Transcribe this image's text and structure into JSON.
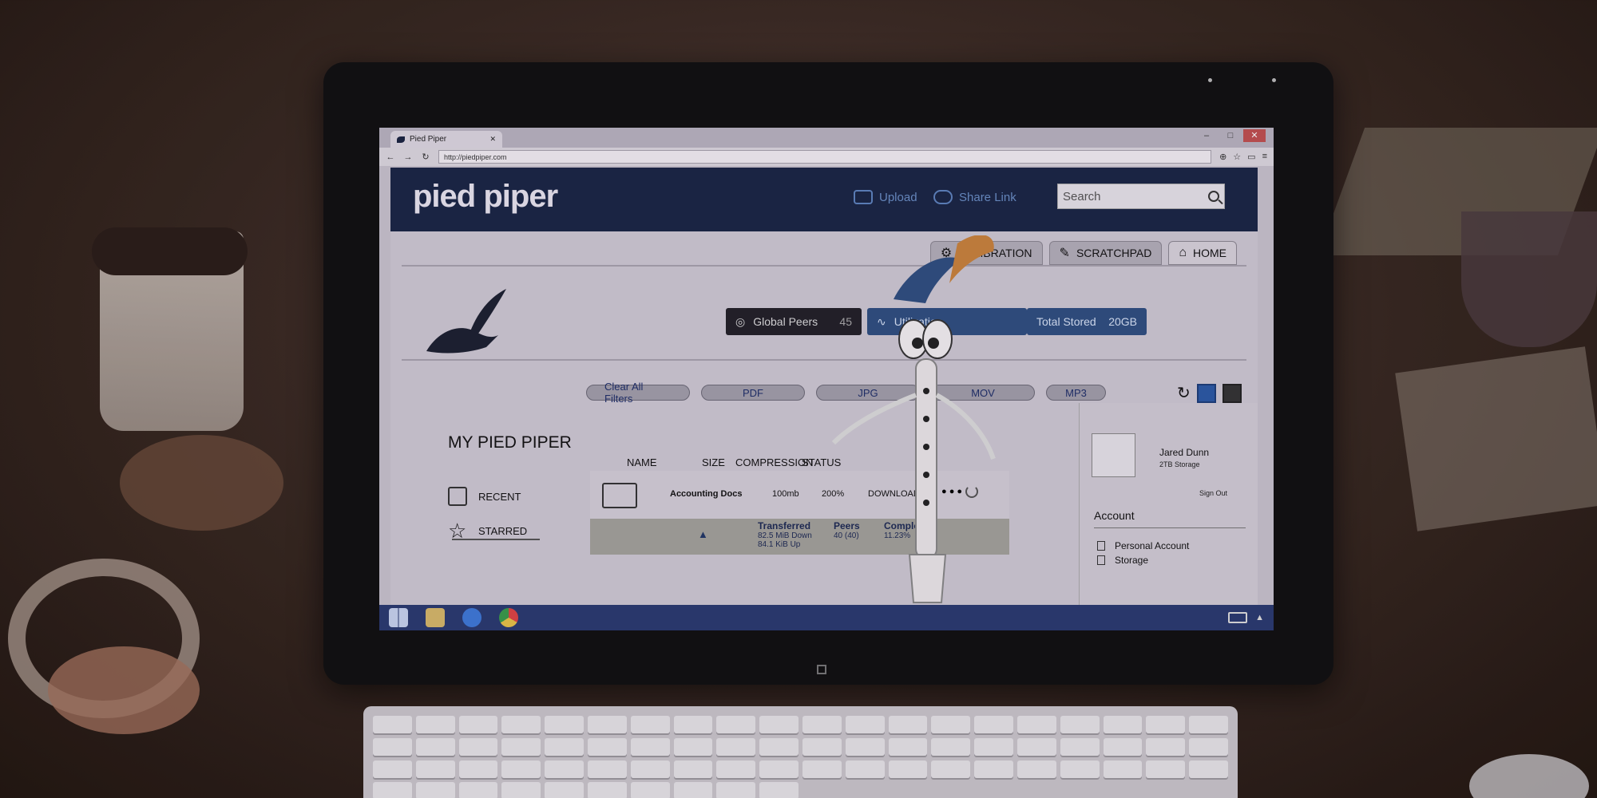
{
  "browser": {
    "tab_title": "Pied Piper",
    "url": "http://piedpiper.com",
    "win_minimize": "–",
    "win_maximize": "□",
    "win_close": "✕"
  },
  "header": {
    "logo": "pied piper",
    "upload_label": "Upload",
    "share_label": "Share Link",
    "search_placeholder": "Search"
  },
  "nav_tabs": {
    "calibration": "CALIBRATION",
    "scratchpad": "SCRATCHPAD",
    "home": "HOME"
  },
  "stats": {
    "peers_label": "Global Peers",
    "peers_value": "45",
    "utilization_label": "Utilization",
    "stored_label": "Total Stored",
    "stored_value": "20GB"
  },
  "filters": [
    "Clear All Filters",
    "PDF",
    "JPG",
    "MOV",
    "MP3"
  ],
  "sidebar": {
    "title": "MY PIED PIPER",
    "items": [
      "RECENT",
      "STARRED"
    ]
  },
  "table": {
    "headers": [
      "NAME",
      "SIZE",
      "COMPRESSION",
      "STATUS"
    ],
    "row": {
      "name": "Accounting Docs",
      "size": "100mb",
      "compression": "200%",
      "status": "DOWNLOADING",
      "dots": "● ● ●"
    },
    "progress": {
      "transferred_label": "Transferred",
      "transferred_down": "82.5 MiB Down",
      "transferred_up": "84.1 KiB Up",
      "peers_label": "Peers",
      "peers_value": "40 (40)",
      "complete_label": "Complete",
      "complete_value": "11.23%"
    }
  },
  "user": {
    "name": "Jared Dunn",
    "storage": "2TB Storage",
    "sign_out": "Sign Out",
    "account_title": "Account",
    "account_items": [
      "Personal Account",
      "Storage"
    ]
  },
  "colors": {
    "header_bg": "#1a2545",
    "accent_blue": "#2f4f80",
    "taskbar": "#2a3a70"
  }
}
